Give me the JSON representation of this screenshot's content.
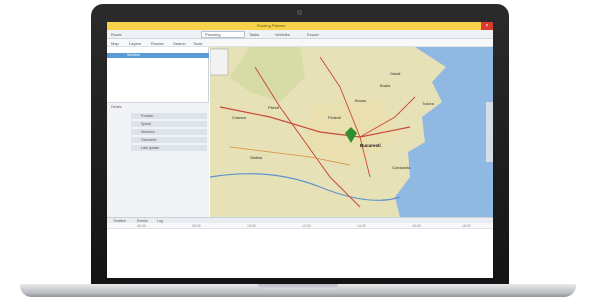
{
  "app": {
    "title": "Routing Planner",
    "close_glyph": "×"
  },
  "toolbar": {
    "items": [
      "Route",
      "Planning",
      "Tasks",
      "Vehicles",
      "Export"
    ]
  },
  "menubar": {
    "items": [
      "Map",
      "Layers",
      "Routes",
      "Search",
      "Tools"
    ]
  },
  "sidebar": {
    "selected_item": "Vehicles",
    "section_header": "Details",
    "rows": [
      "Position",
      "Speed",
      "Direction",
      "Odometer",
      "Last update"
    ]
  },
  "map": {
    "water_color": "#8fb8e3",
    "land_color": "#e6e1b6",
    "road_color": "#c94a3a",
    "marker_color": "#2f8f2f",
    "cities": [
      "Craiova",
      "Pitesti",
      "Ploiesti",
      "Bucuresti",
      "Constanta",
      "Braila",
      "Galati",
      "Buzau",
      "Slatina",
      "Tulcea"
    ]
  },
  "bottombar": {
    "tabs": [
      "Timeline",
      "Events",
      "Log"
    ]
  },
  "timeline": {
    "ticks": [
      "06:00",
      "08:00",
      "10:00",
      "12:00",
      "14:00",
      "16:00",
      "18:00"
    ]
  }
}
